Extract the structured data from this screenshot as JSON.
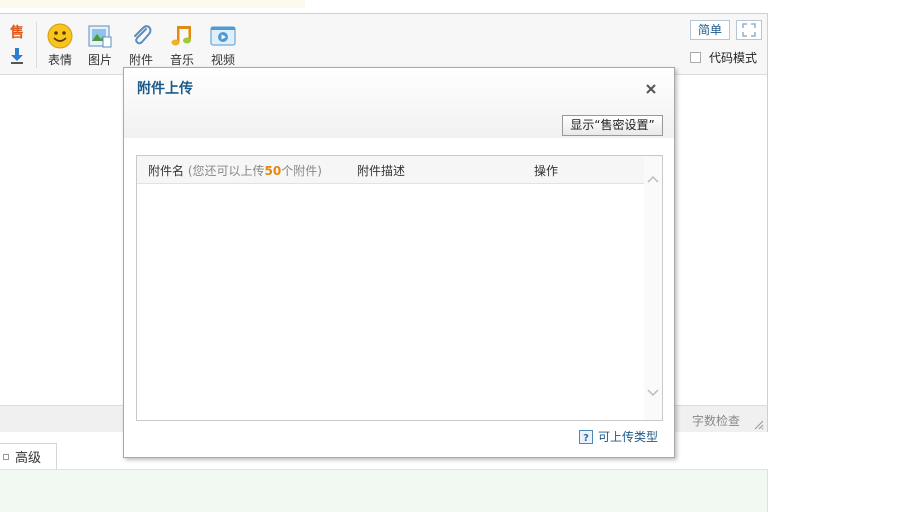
{
  "toolbar": {
    "buttons": [
      {
        "label": "表情",
        "icon": "smiley-icon"
      },
      {
        "label": "图片",
        "icon": "image-icon"
      },
      {
        "label": "附件",
        "icon": "paperclip-icon"
      },
      {
        "label": "音乐",
        "icon": "music-icon"
      },
      {
        "label": "视频",
        "icon": "video-icon"
      }
    ],
    "sale_icon_text": "售",
    "simple_label": "简单",
    "code_mode_label": "代码模式"
  },
  "statusbar": {
    "word_check": "字数检查"
  },
  "advanced_tab": {
    "label": "高级"
  },
  "dialog": {
    "title": "附件上传",
    "close_glyph": "×",
    "show_sale_settings": "显示“售密设置”",
    "table": {
      "col_name": "附件名",
      "hint_prefix": "(您还可以上传",
      "hint_count": "50",
      "hint_suffix": "个附件)",
      "col_desc": "附件描述",
      "col_action": "操作"
    },
    "upload_types_link": "可上传类型"
  },
  "colors": {
    "accent": "#1c5a8a",
    "count_highlight": "#e5870a",
    "advanced_panel_bg": "#f2f9f2"
  }
}
